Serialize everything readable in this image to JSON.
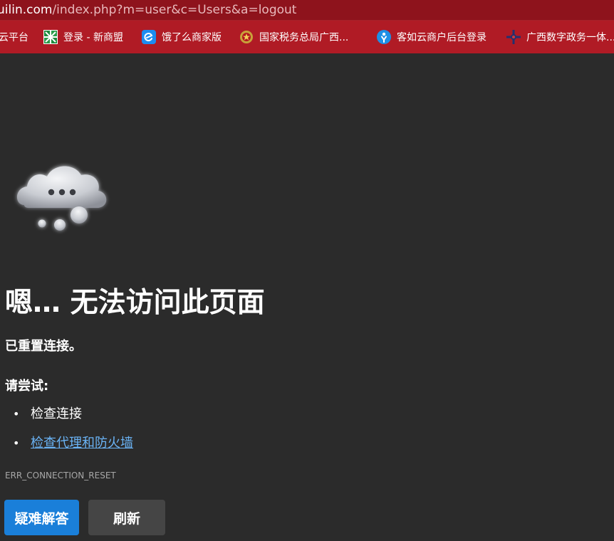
{
  "address_bar": {
    "host": "uilin.com",
    "path": "/index.php?m=user&c=Users&a=logout"
  },
  "bookmarks": [
    {
      "label": "云平台",
      "icon": "none"
    },
    {
      "label": "登录 - 新商盟",
      "icon": "grid-logo-icon"
    },
    {
      "label": "饿了么商家版",
      "icon": "eleme-icon"
    },
    {
      "label": "国家税务总局广西...",
      "icon": "tax-emblem-icon"
    },
    {
      "label": "客如云商户后台登录",
      "icon": "keruyun-icon"
    },
    {
      "label": "广西数字政务一体...",
      "icon": "gov-service-icon"
    }
  ],
  "error_page": {
    "title": "嗯… 无法访问此页面",
    "subtitle": "已重置连接。",
    "try_label": "请尝试:",
    "suggestions": [
      {
        "text": "检查连接",
        "link": false
      },
      {
        "text": "检查代理和防火墙",
        "link": true
      }
    ],
    "error_code": "ERR_CONNECTION_RESET",
    "buttons": {
      "troubleshoot": "疑难解答",
      "refresh": "刷新"
    }
  },
  "colors": {
    "address_bar_bg": "#8e131c",
    "bookmarks_bar_bg": "#b01b25",
    "page_bg": "#2b2b2b",
    "primary_button": "#1a7fd9",
    "secondary_button": "#454545",
    "link": "#6ab3f5"
  }
}
